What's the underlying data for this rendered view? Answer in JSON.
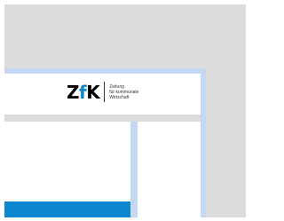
{
  "logo": {
    "mark_z": "Z",
    "mark_f": "f",
    "mark_k": "K",
    "tagline_line1": "Zeitung",
    "tagline_line2": "für kommunale",
    "tagline_line3": "Wirtschaft",
    "accent_color": "#0b86cf"
  },
  "colors": {
    "background": "#dcdcdc",
    "frame": "#c4d8f1",
    "panel": "#ffffff",
    "accent_bar": "#0b86cf"
  }
}
